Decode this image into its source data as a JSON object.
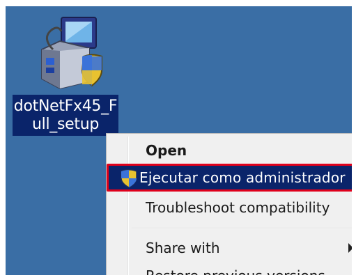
{
  "desktop": {
    "background": "#3a6ea5",
    "icon": {
      "label": "dotNetFx45_F\null_setup",
      "icon_name": "installer-package-icon"
    }
  },
  "context_menu": {
    "items": [
      {
        "label": "Open"
      },
      {
        "label": "Ejecutar como administrador",
        "icon_name": "uac-shield-icon",
        "highlighted": true
      },
      {
        "label": "Troubleshoot compatibility"
      },
      {
        "label": "Share with",
        "has_submenu": true
      },
      {
        "label": "Restore previous versions"
      }
    ],
    "highlight_color": "#0a246a",
    "annotation_border_color": "#e0001b"
  }
}
